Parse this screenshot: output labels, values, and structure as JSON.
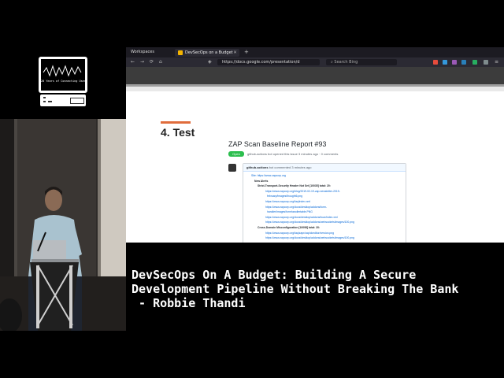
{
  "logo": {
    "text": "20 Years of Connecting Users"
  },
  "browser": {
    "tabbar": {
      "workspaces": "Workspaces",
      "tab_title": "DevSecOps on a Budget -",
      "close": "×",
      "new_tab": "+"
    },
    "nav": {
      "back": "←",
      "forward": "→",
      "reload": "⟳",
      "home": "⌂",
      "url": "https://docs.google.com/presentation/d",
      "search_placeholder": "Search Bing",
      "menu": "≡"
    },
    "slide": {
      "title": "4. Test",
      "report_title": "ZAP Scan Baseline Report #93",
      "status_badge": "Open",
      "meta": "github-actions  bot opened this issue 3 minutes ago · 0 comments",
      "comment_header_author": "github-actions",
      "comment_header_rest": "bot commented 3 minutes ago",
      "lines": [
        {
          "text": "Site: https://www.zapcorp.org",
          "type": "link"
        },
        {
          "text": "New Alerts",
          "type": "bold"
        },
        {
          "text": "Strict-Transport-Security Header Not Set [10035] total: 20:",
          "type": "bold"
        },
        {
          "text": "https://www.zapcorp.org/blog/2019-02-19-zap-newsletter-2019-",
          "type": "link"
        },
        {
          "text": "february/images/thought6.png",
          "type": "link"
        },
        {
          "text": "https://www.zapcorp.org/faq/index.xml",
          "type": "link"
        },
        {
          "text": "https://www.zapcorp.org/docs/desktop/addons/form-",
          "type": "link"
        },
        {
          "text": "handler/images/formhandlertable.PNG",
          "type": "link"
        },
        {
          "text": "https://www.zapcorp.org/docs/desktop/addons/fuzz/index.xml",
          "type": "link"
        },
        {
          "text": "https://www.zapcorp.org/docs/desktop/addons/websockets/images/100.png",
          "type": "link"
        },
        {
          "text": "Cross-Domain Misconfiguration [10098] total: 20:",
          "type": "bold"
        },
        {
          "text": "https://www.zapcorp.org/faq/zapr/zap/ckeditor/version.png",
          "type": "link"
        },
        {
          "text": "https://www.zapcorp.org/docs/desktop/addons/websockets/images/100.png",
          "type": "link"
        }
      ]
    }
  },
  "caption": {
    "line1": "DevSecOps On A Budget: Building A Secure",
    "line2": "Development Pipeline Without Breaking The Bank",
    "line3": " - Robbie Thandi"
  },
  "colors": {
    "accent": "#e06c3c",
    "open_badge": "#2cbe4e",
    "link": "#0366d6"
  }
}
